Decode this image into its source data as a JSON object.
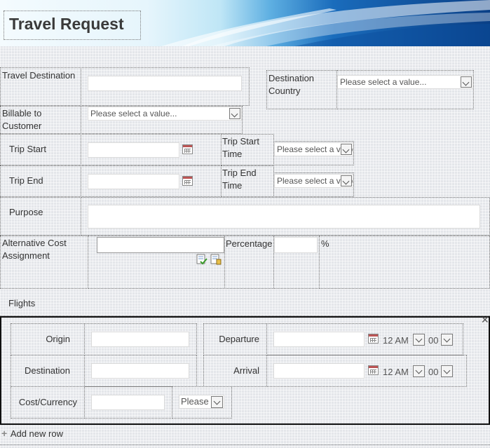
{
  "header": {
    "title": "Travel Request"
  },
  "form": {
    "travel_destination_label": "Travel Destination",
    "destination_country_label": "Destination Country",
    "destination_country_select": "Please select a value...",
    "billable_label": "Billable to Customer",
    "billable_select": "Please select a value...",
    "trip_start_label": "Trip Start",
    "trip_start_time_label": "Trip Start Time",
    "trip_start_time_select": "Please select a value...",
    "trip_end_label": "Trip End",
    "trip_end_time_label": "Trip End Time",
    "trip_end_time_select": "Please select a value...",
    "purpose_label": "Purpose",
    "alt_cost_label": "Alternative Cost Assignment",
    "percentage_label": "Percentage",
    "percent_sign": "%"
  },
  "flights": {
    "section_label": "Flights",
    "close_glyph": "✕",
    "origin_label": "Origin",
    "destination_label": "Destination",
    "cost_currency_label": "Cost/Currency",
    "currency_select": "Please",
    "departure_label": "Departure",
    "arrival_label": "Arrival",
    "departure_hour": "12 AM",
    "departure_minute": "00",
    "arrival_hour": "12 AM",
    "arrival_minute": "00",
    "add_row_label": "Add new row",
    "add_icon": "+"
  },
  "colors": {
    "banner_dark": "#0a3f86",
    "banner_light": "#dff2fb",
    "title_text": "#3a3a3a"
  }
}
